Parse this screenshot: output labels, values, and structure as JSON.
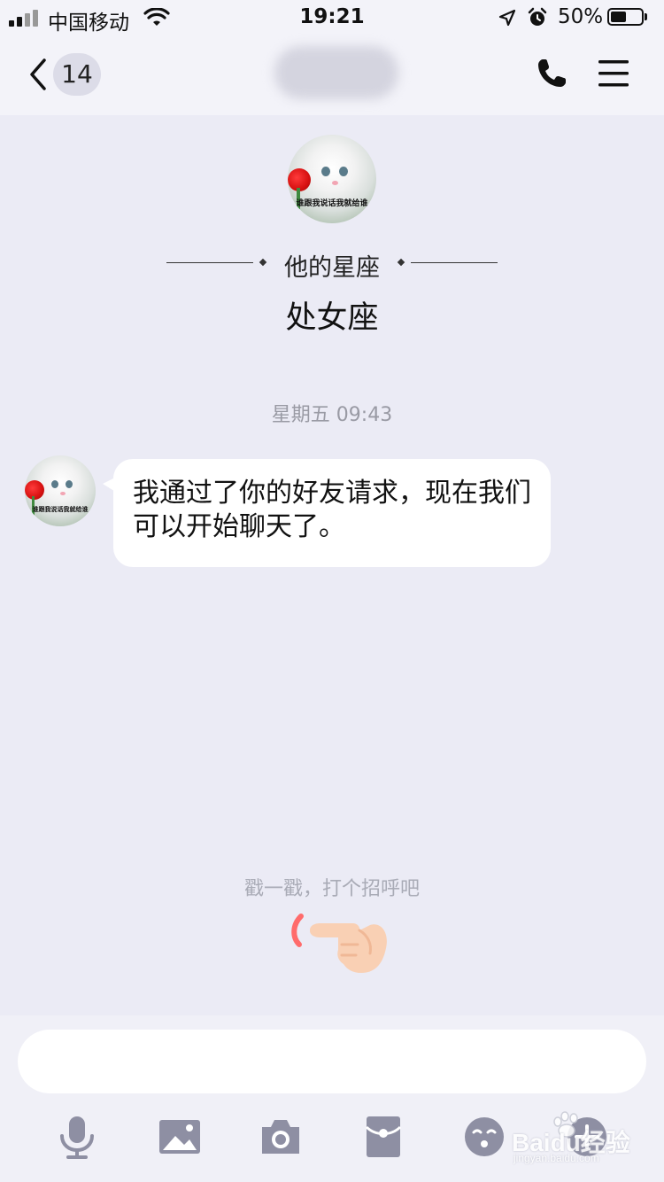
{
  "status_bar": {
    "carrier": "中国移动",
    "time": "19:21",
    "battery_percent": "50%"
  },
  "nav": {
    "unread_count": "14"
  },
  "profile": {
    "avatar_caption": "谁跟我说话我就给谁",
    "zodiac_label": "他的星座",
    "zodiac_value": "处女座"
  },
  "chat": {
    "timestamp": "星期五 09:43",
    "messages": [
      {
        "text": "我通过了你的好友请求，现在我们可以开始聊天了。"
      }
    ],
    "poke_hint": "戳一戳，打个招呼吧"
  },
  "input": {
    "placeholder": ""
  },
  "toolbar": {
    "icons": [
      "microphone-icon",
      "image-icon",
      "camera-icon",
      "red-packet-icon",
      "emoji-icon",
      "plus-icon"
    ]
  },
  "watermark": {
    "text": "Baidu经验",
    "subtext": "jingyan.baidu.com"
  },
  "colors": {
    "background": "#ebebf5",
    "bubble": "#ffffff",
    "icon_gray": "#8e8fa3",
    "poke_accent": "#ff6b6b"
  }
}
